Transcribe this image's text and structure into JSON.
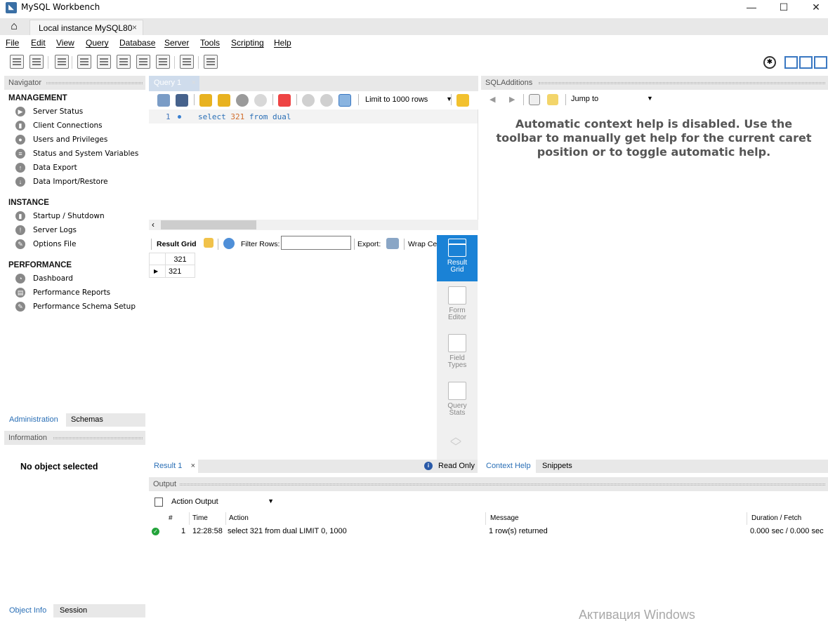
{
  "window": {
    "title": "MySQL Workbench",
    "controls": {
      "minimize": "—",
      "maximize": "☐",
      "close": "✕"
    }
  },
  "tabbar": {
    "connection_tab": "Local instance MySQL80",
    "close": "×"
  },
  "menu": [
    "File",
    "Edit",
    "View",
    "Query",
    "Database",
    "Server",
    "Tools",
    "Scripting",
    "Help"
  ],
  "navigator": {
    "title": "Navigator",
    "sections": [
      {
        "title": "MANAGEMENT",
        "items": [
          "Server Status",
          "Client Connections",
          "Users and Privileges",
          "Status and System Variables",
          "Data Export",
          "Data Import/Restore"
        ]
      },
      {
        "title": "INSTANCE",
        "items": [
          "Startup / Shutdown",
          "Server Logs",
          "Options File"
        ]
      },
      {
        "title": "PERFORMANCE",
        "items": [
          "Dashboard",
          "Performance Reports",
          "Performance Schema Setup"
        ]
      }
    ],
    "tabs": [
      "Administration",
      "Schemas"
    ]
  },
  "information": {
    "title": "Information",
    "message": "No object selected",
    "tabs": [
      "Object Info",
      "Session"
    ]
  },
  "query": {
    "tab_label": "Query 1",
    "limit_label": "Limit to 1000 rows",
    "editor": {
      "line_number": "1",
      "tokens": [
        "select",
        "321",
        "from",
        "dual"
      ]
    }
  },
  "result": {
    "toolbar": {
      "grid_label": "Result Grid",
      "filter_label": "Filter Rows:",
      "filter_value": "",
      "export_label": "Export:",
      "wrap_label": "Wrap Ce"
    },
    "columns": [
      "321"
    ],
    "rows": [
      [
        "321"
      ]
    ],
    "side_views": [
      "Result Grid",
      "Form Editor",
      "Field Types",
      "Query Stats"
    ],
    "tab_label": "Result 1",
    "read_only": "Read Only"
  },
  "sql_additions": {
    "title": "SQLAdditions",
    "jump_to": "Jump to",
    "help_text": "Automatic context help is disabled. Use the toolbar to manually get help for the current caret position or to toggle automatic help.",
    "tabs": [
      "Context Help",
      "Snippets"
    ]
  },
  "output": {
    "title": "Output",
    "selector": "Action Output",
    "columns": [
      "#",
      "Time",
      "Action",
      "Message",
      "Duration / Fetch"
    ],
    "rows": [
      {
        "num": "1",
        "time": "12:28:58",
        "action": "select 321 from dual LIMIT 0, 1000",
        "message": "1 row(s) returned",
        "duration": "0.000 sec / 0.000 sec"
      }
    ]
  },
  "watermark": "Активация Windows"
}
